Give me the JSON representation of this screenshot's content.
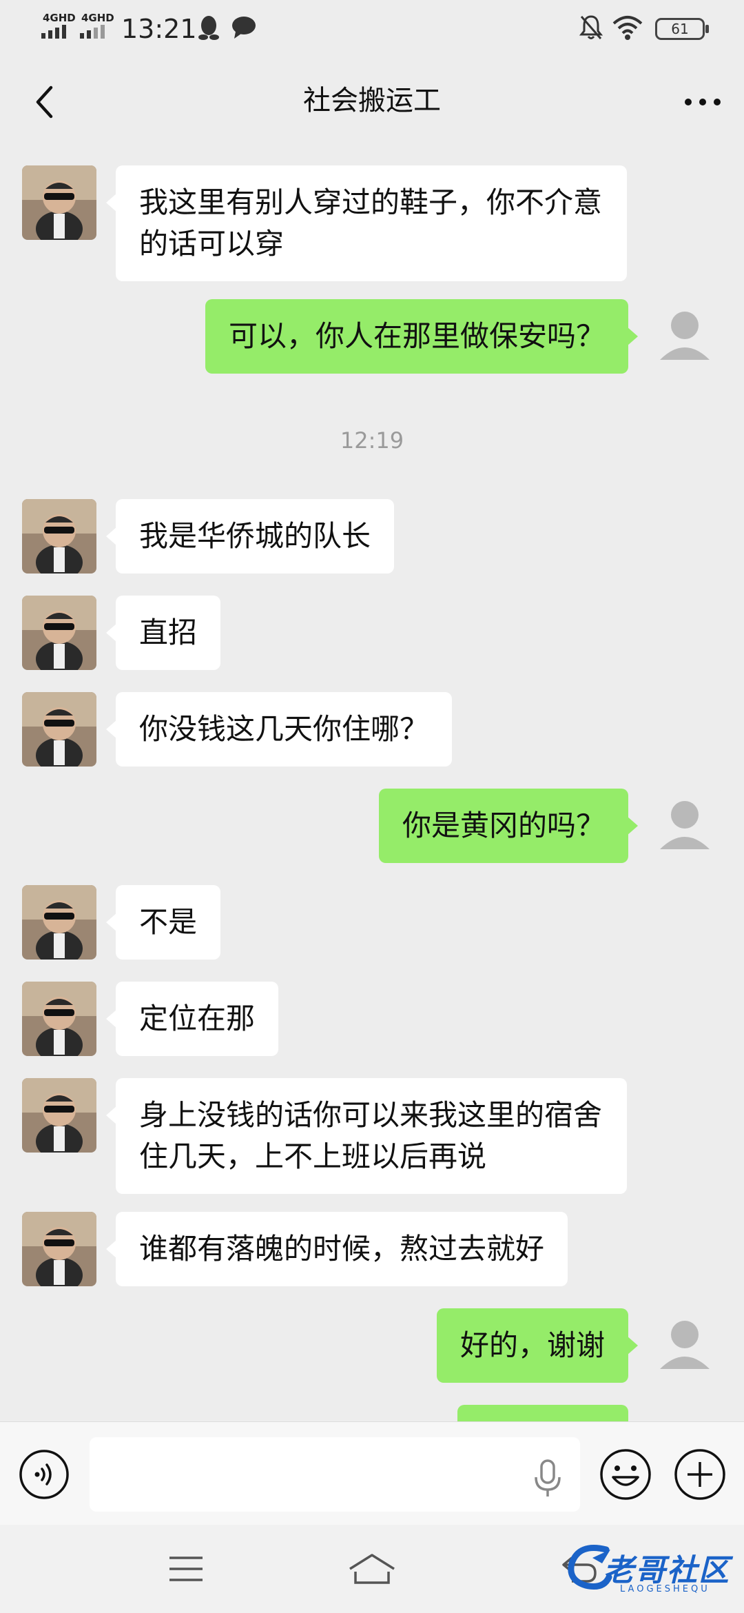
{
  "status_bar": {
    "network_1": "4GHD",
    "network_2": "4GHD",
    "time": "13:21",
    "battery": "61"
  },
  "header": {
    "title": "社会搬运工"
  },
  "chat": {
    "messages": [
      {
        "side": "in",
        "text": "我这里有别人穿过的鞋子，你不介意的话可以穿"
      },
      {
        "side": "out",
        "text": "可以，你人在那里做保安吗？"
      },
      {
        "type": "time",
        "text": "12:19"
      },
      {
        "side": "in",
        "text": "我是华侨城的队长"
      },
      {
        "side": "in",
        "text": "直招"
      },
      {
        "side": "in",
        "text": "你没钱这几天你住哪？"
      },
      {
        "side": "out",
        "text": "你是黄冈的吗？"
      },
      {
        "side": "in",
        "text": "不是"
      },
      {
        "side": "in",
        "text": "定位在那"
      },
      {
        "side": "in",
        "text": "身上没钱的话你可以来我这里的宿舍住几天，上不上班以后再说"
      },
      {
        "side": "in",
        "text": "谁都有落魄的时候，熬过去就好"
      },
      {
        "side": "out",
        "text": "好的，谢谢"
      },
      {
        "side": "out",
        "text": ""
      }
    ]
  },
  "input_bar": {
    "value": "",
    "placeholder": ""
  },
  "watermark": {
    "text": "老哥社区",
    "sub": "LAOGESHEQU"
  },
  "colors": {
    "background": "#ededed",
    "outgoing_bubble": "#95ec69",
    "incoming_bubble": "#ffffff",
    "timestamp": "#9a9a9a"
  },
  "icons": [
    "signal-icon",
    "qq-icon",
    "chat-icon",
    "mute-bell-icon",
    "wifi-icon",
    "battery-icon",
    "back-chevron-icon",
    "more-dots-icon",
    "voice-icon",
    "mic-icon",
    "emoji-icon",
    "plus-icon",
    "menu-icon",
    "home-icon",
    "back-icon"
  ]
}
